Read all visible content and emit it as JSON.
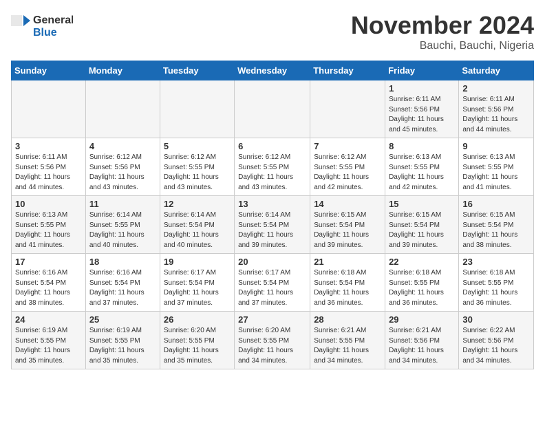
{
  "header": {
    "logo_general": "General",
    "logo_blue": "Blue",
    "month": "November 2024",
    "location": "Bauchi, Bauchi, Nigeria"
  },
  "days_of_week": [
    "Sunday",
    "Monday",
    "Tuesday",
    "Wednesday",
    "Thursday",
    "Friday",
    "Saturday"
  ],
  "weeks": [
    [
      {
        "day": "",
        "info": ""
      },
      {
        "day": "",
        "info": ""
      },
      {
        "day": "",
        "info": ""
      },
      {
        "day": "",
        "info": ""
      },
      {
        "day": "",
        "info": ""
      },
      {
        "day": "1",
        "info": "Sunrise: 6:11 AM\nSunset: 5:56 PM\nDaylight: 11 hours and 45 minutes."
      },
      {
        "day": "2",
        "info": "Sunrise: 6:11 AM\nSunset: 5:56 PM\nDaylight: 11 hours and 44 minutes."
      }
    ],
    [
      {
        "day": "3",
        "info": "Sunrise: 6:11 AM\nSunset: 5:56 PM\nDaylight: 11 hours and 44 minutes."
      },
      {
        "day": "4",
        "info": "Sunrise: 6:12 AM\nSunset: 5:56 PM\nDaylight: 11 hours and 43 minutes."
      },
      {
        "day": "5",
        "info": "Sunrise: 6:12 AM\nSunset: 5:55 PM\nDaylight: 11 hours and 43 minutes."
      },
      {
        "day": "6",
        "info": "Sunrise: 6:12 AM\nSunset: 5:55 PM\nDaylight: 11 hours and 43 minutes."
      },
      {
        "day": "7",
        "info": "Sunrise: 6:12 AM\nSunset: 5:55 PM\nDaylight: 11 hours and 42 minutes."
      },
      {
        "day": "8",
        "info": "Sunrise: 6:13 AM\nSunset: 5:55 PM\nDaylight: 11 hours and 42 minutes."
      },
      {
        "day": "9",
        "info": "Sunrise: 6:13 AM\nSunset: 5:55 PM\nDaylight: 11 hours and 41 minutes."
      }
    ],
    [
      {
        "day": "10",
        "info": "Sunrise: 6:13 AM\nSunset: 5:55 PM\nDaylight: 11 hours and 41 minutes."
      },
      {
        "day": "11",
        "info": "Sunrise: 6:14 AM\nSunset: 5:55 PM\nDaylight: 11 hours and 40 minutes."
      },
      {
        "day": "12",
        "info": "Sunrise: 6:14 AM\nSunset: 5:54 PM\nDaylight: 11 hours and 40 minutes."
      },
      {
        "day": "13",
        "info": "Sunrise: 6:14 AM\nSunset: 5:54 PM\nDaylight: 11 hours and 39 minutes."
      },
      {
        "day": "14",
        "info": "Sunrise: 6:15 AM\nSunset: 5:54 PM\nDaylight: 11 hours and 39 minutes."
      },
      {
        "day": "15",
        "info": "Sunrise: 6:15 AM\nSunset: 5:54 PM\nDaylight: 11 hours and 39 minutes."
      },
      {
        "day": "16",
        "info": "Sunrise: 6:15 AM\nSunset: 5:54 PM\nDaylight: 11 hours and 38 minutes."
      }
    ],
    [
      {
        "day": "17",
        "info": "Sunrise: 6:16 AM\nSunset: 5:54 PM\nDaylight: 11 hours and 38 minutes."
      },
      {
        "day": "18",
        "info": "Sunrise: 6:16 AM\nSunset: 5:54 PM\nDaylight: 11 hours and 37 minutes."
      },
      {
        "day": "19",
        "info": "Sunrise: 6:17 AM\nSunset: 5:54 PM\nDaylight: 11 hours and 37 minutes."
      },
      {
        "day": "20",
        "info": "Sunrise: 6:17 AM\nSunset: 5:54 PM\nDaylight: 11 hours and 37 minutes."
      },
      {
        "day": "21",
        "info": "Sunrise: 6:18 AM\nSunset: 5:54 PM\nDaylight: 11 hours and 36 minutes."
      },
      {
        "day": "22",
        "info": "Sunrise: 6:18 AM\nSunset: 5:55 PM\nDaylight: 11 hours and 36 minutes."
      },
      {
        "day": "23",
        "info": "Sunrise: 6:18 AM\nSunset: 5:55 PM\nDaylight: 11 hours and 36 minutes."
      }
    ],
    [
      {
        "day": "24",
        "info": "Sunrise: 6:19 AM\nSunset: 5:55 PM\nDaylight: 11 hours and 35 minutes."
      },
      {
        "day": "25",
        "info": "Sunrise: 6:19 AM\nSunset: 5:55 PM\nDaylight: 11 hours and 35 minutes."
      },
      {
        "day": "26",
        "info": "Sunrise: 6:20 AM\nSunset: 5:55 PM\nDaylight: 11 hours and 35 minutes."
      },
      {
        "day": "27",
        "info": "Sunrise: 6:20 AM\nSunset: 5:55 PM\nDaylight: 11 hours and 34 minutes."
      },
      {
        "day": "28",
        "info": "Sunrise: 6:21 AM\nSunset: 5:55 PM\nDaylight: 11 hours and 34 minutes."
      },
      {
        "day": "29",
        "info": "Sunrise: 6:21 AM\nSunset: 5:56 PM\nDaylight: 11 hours and 34 minutes."
      },
      {
        "day": "30",
        "info": "Sunrise: 6:22 AM\nSunset: 5:56 PM\nDaylight: 11 hours and 34 minutes."
      }
    ]
  ]
}
